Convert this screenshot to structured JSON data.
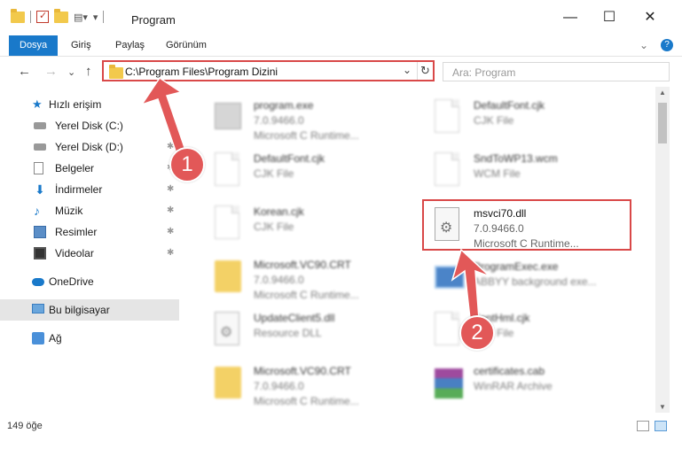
{
  "window": {
    "title": "Program",
    "minimize": "—",
    "maximize": "☐",
    "close": "✕"
  },
  "ribbon": {
    "tabs": [
      "Dosya",
      "Giriş",
      "Paylaş",
      "Görünüm"
    ],
    "expand": "⌄",
    "help": "?"
  },
  "address": {
    "path": "C:\\Program Files\\Program Dizini",
    "dropdown": "⌄",
    "refresh": "↻"
  },
  "search": {
    "placeholder": "Ara: Program"
  },
  "nav": {
    "back": "←",
    "forward": "→",
    "recent": "⌄",
    "up": "↑",
    "items": [
      {
        "label": "Hızlı erişim",
        "icon": "star-icon",
        "pinned": false
      },
      {
        "label": "Yerel Disk (C:)",
        "icon": "disk-icon",
        "pinned": true
      },
      {
        "label": "Yerel Disk (D:)",
        "icon": "disk-icon",
        "pinned": true
      },
      {
        "label": "Belgeler",
        "icon": "documents-icon",
        "pinned": true
      },
      {
        "label": "İndirmeler",
        "icon": "download-icon",
        "pinned": true
      },
      {
        "label": "Müzik",
        "icon": "music-icon",
        "pinned": true
      },
      {
        "label": "Resimler",
        "icon": "pictures-icon",
        "pinned": true
      },
      {
        "label": "Videolar",
        "icon": "videos-icon",
        "pinned": true
      },
      {
        "label": "OneDrive",
        "icon": "cloud-icon",
        "pinned": false
      },
      {
        "label": "Bu bilgisayar",
        "icon": "computer-icon",
        "pinned": false
      },
      {
        "label": "Ağ",
        "icon": "network-icon",
        "pinned": false
      }
    ]
  },
  "files": {
    "left": [
      {
        "name": "program.exe",
        "line1": "7.0.9466.0",
        "line2": "Microsoft C Runtime..."
      },
      {
        "name": "DefaultFont.cjk",
        "line1": "CJK File",
        "line2": ""
      },
      {
        "name": "Korean.cjk",
        "line1": "CJK File",
        "line2": ""
      },
      {
        "name": "Microsoft.VC90.CRT",
        "line1": "7.0.9466.0",
        "line2": "Microsoft C Runtime..."
      },
      {
        "name": "UpdateClient5.dll",
        "line1": "Resource DLL",
        "line2": ""
      },
      {
        "name": "Microsoft.VC90.CRT",
        "line1": "7.0.9466.0",
        "line2": "Microsoft C Runtime..."
      }
    ],
    "right": [
      {
        "name": "DefaultFont.cjk",
        "line1": "CJK File",
        "line2": ""
      },
      {
        "name": "SndToWP13.wcm",
        "line1": "WCM File",
        "line2": ""
      },
      {
        "name": "msvci70.dll",
        "line1": "7.0.9466.0",
        "line2": "Microsoft C Runtime..."
      },
      {
        "name": "ProgramExec.exe",
        "line1": "ABBYY background exe...",
        "line2": ""
      },
      {
        "name": "FontHml.cjk",
        "line1": "CJK File",
        "line2": ""
      },
      {
        "name": "certificates.cab",
        "line1": "WinRAR Archive",
        "line2": ""
      }
    ]
  },
  "status": {
    "count": "149 öğe"
  },
  "callouts": [
    "1",
    "2"
  ]
}
